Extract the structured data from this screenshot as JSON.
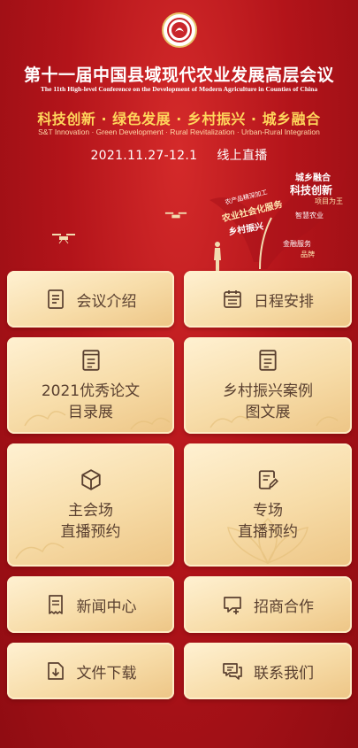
{
  "header": {
    "title": "第十一届中国县域现代农业发展高层会议",
    "subtitle": "The 11th High-level Conference on the Development of Modern Agriculture in Counties of China",
    "slogan": "科技创新 · 绿色发展 · 乡村振兴 · 城乡融合",
    "slogan_en": "S&T Innovation · Green Development · Rural Revitalization · Urban-Rural Integration",
    "date": "2021.11.27-12.1",
    "live": "线上直播",
    "wordcloud": [
      "城乡融合",
      "科技创新",
      "农业社会化服务",
      "乡村振兴",
      "项目为王",
      "金融服务",
      "农产品精深加工",
      "智慧农业",
      "品牌"
    ]
  },
  "colors": {
    "bg": "#b3141a",
    "tile": "#f7dca8",
    "gold": "#ffd65c",
    "text": "#5a4030"
  },
  "menu": {
    "conference_intro": {
      "label": "会议介绍",
      "icon": "document-icon"
    },
    "schedule": {
      "label": "日程安排",
      "icon": "calendar-icon"
    },
    "papers": {
      "line1": "2021优秀论文",
      "line2": "目录展",
      "icon": "notebook-icon"
    },
    "cases": {
      "line1": "乡村振兴案例",
      "line2": "图文展",
      "icon": "notebook-icon"
    },
    "main_venue": {
      "line1": "主会场",
      "line2": "直播预约",
      "icon": "cube-icon"
    },
    "sub_venue": {
      "line1": "专场",
      "line2": "直播预约",
      "icon": "edit-document-icon"
    },
    "news": {
      "label": "新闻中心",
      "icon": "receipt-icon"
    },
    "investment": {
      "label": "招商合作",
      "icon": "chat-plus-icon"
    },
    "downloads": {
      "label": "文件下载",
      "icon": "download-file-icon"
    },
    "contact": {
      "label": "联系我们",
      "icon": "chat-bubbles-icon"
    }
  }
}
